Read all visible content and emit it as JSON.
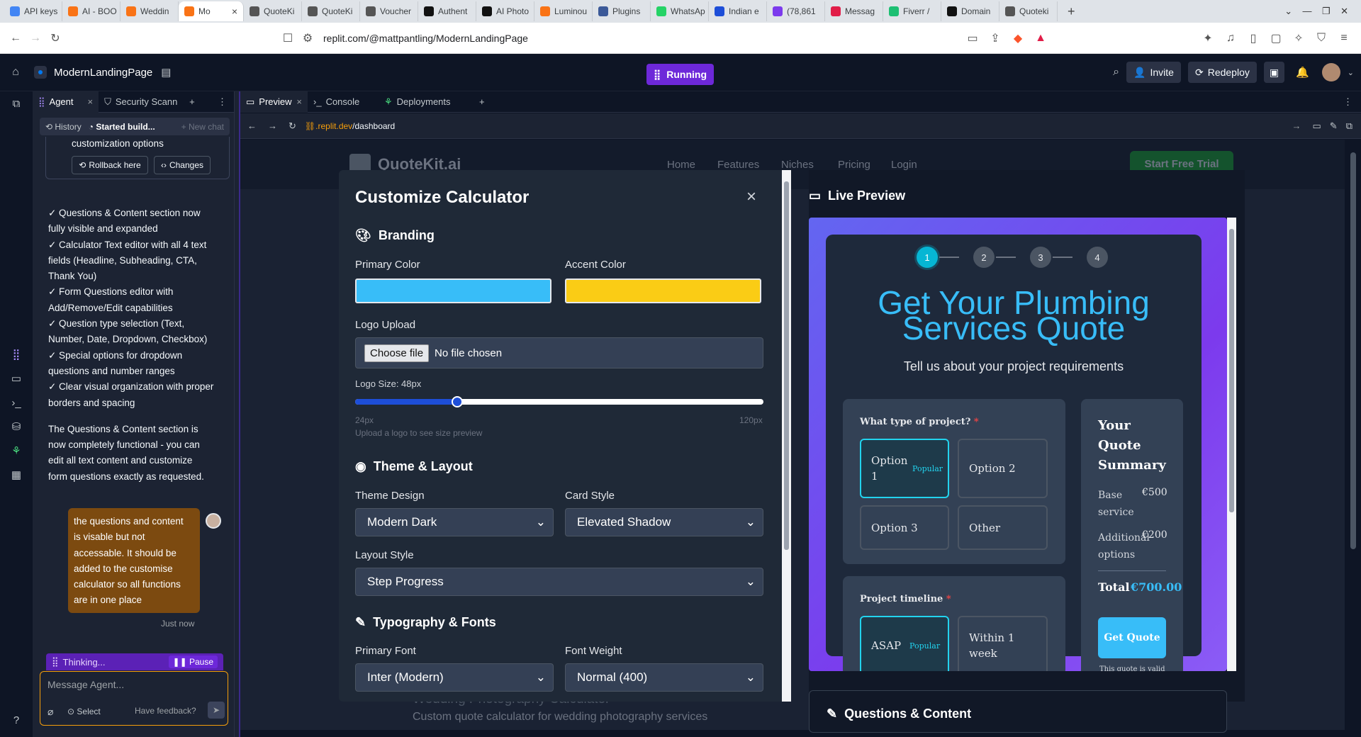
{
  "browser": {
    "tabs": [
      {
        "label": "API keys",
        "color": "#4285f4"
      },
      {
        "label": "AI - BOO",
        "color": "#f97316"
      },
      {
        "label": "Weddin",
        "color": "#f97316"
      },
      {
        "label": "Mo",
        "color": "#f97316",
        "active": true
      },
      {
        "label": "QuoteKi",
        "color": "#555555"
      },
      {
        "label": "QuoteKi",
        "color": "#555555"
      },
      {
        "label": "Voucher",
        "color": "#555555"
      },
      {
        "label": "Authent",
        "color": "#111111"
      },
      {
        "label": "AI Photo",
        "color": "#111111"
      },
      {
        "label": "Luminou",
        "color": "#f97316"
      },
      {
        "label": "Plugins",
        "color": "#3b5998"
      },
      {
        "label": "WhatsAp",
        "color": "#25d366"
      },
      {
        "label": "Indian e",
        "color": "#1d4ed8"
      },
      {
        "label": "(78,861",
        "color": "#7c3aed"
      },
      {
        "label": "Messag",
        "color": "#e11d48"
      },
      {
        "label": "Fiverr /",
        "color": "#1dbf73"
      },
      {
        "label": "Domain",
        "color": "#111111"
      },
      {
        "label": "Quoteki",
        "color": "#555555"
      }
    ],
    "url": "replit.com/@mattpantling/ModernLandingPage"
  },
  "replit": {
    "project_name": "ModernLandingPage",
    "run_status": "Running",
    "invite_label": "Invite",
    "redeploy_label": "Redeploy"
  },
  "agent_panel": {
    "tab_agent": "Agent",
    "tab_security": "Security Scann",
    "history_label": "History",
    "started_label": "Started build...",
    "new_chat_label": "New chat",
    "customization_text": "customization options",
    "rollback_label": "Rollback here",
    "changes_label": "Changes",
    "lines": [
      "✓ Questions & Content section now",
      "fully visible and expanded",
      "✓ Calculator Text editor with all 4 text",
      "fields (Headline, Subheading, CTA,",
      "Thank You)",
      "✓ Form Questions editor with",
      "Add/Remove/Edit capabilities",
      "✓ Question type selection (Text,",
      "Number, Date, Dropdown, Checkbox)",
      "✓ Special options for dropdown",
      "questions and number ranges",
      "✓ Clear visual organization with proper",
      "borders and spacing"
    ],
    "summary_lines": [
      "The Questions & Content section is",
      "now completely functional - you can",
      "edit all text content and customize",
      "form questions exactly as requested."
    ],
    "user_message_lines": [
      "the questions and content",
      "is visable but not",
      "accessable. It should be",
      "added to the customise",
      "calculator so all functions",
      "are in one place"
    ],
    "timestamp": "Just now",
    "thinking_label": "Thinking...",
    "pause_label": "Pause",
    "input_placeholder": "Message Agent...",
    "select_label": "Select",
    "feedback_label": "Have feedback?"
  },
  "workspace": {
    "tab_preview": "Preview",
    "tab_console": "Console",
    "tab_deployments": "Deployments",
    "url_domain": ".replit.dev",
    "url_path": "/dashboard"
  },
  "site": {
    "logo_text": "QuoteKit.ai",
    "nav": [
      "Home",
      "Features",
      "Niches",
      "Pricing",
      "Login"
    ],
    "cta": "Start Free Trial",
    "bg_card_title": "Wedding Photography Calculator",
    "bg_card_subtitle": "Custom quote calculator for wedding photography services"
  },
  "modal": {
    "title": "Customize Calculator",
    "branding": "Branding",
    "primary_color_label": "Primary Color",
    "primary_color": "#38bdf8",
    "accent_color_label": "Accent Color",
    "accent_color": "#facc15",
    "logo_upload_label": "Logo Upload",
    "choose_file": "Choose file",
    "no_file": "No file chosen",
    "logo_size_label": "Logo Size: 48px",
    "logo_size_value": 48,
    "logo_size_min_label": "24px",
    "logo_size_max_label": "120px",
    "logo_size_min": 24,
    "logo_size_max": 120,
    "logo_hint": "Upload a logo to see size preview",
    "theme_layout": "Theme & Layout",
    "theme_design_label": "Theme Design",
    "theme_design_value": "Modern Dark",
    "card_style_label": "Card Style",
    "card_style_value": "Elevated Shadow",
    "layout_style_label": "Layout Style",
    "layout_style_value": "Step Progress",
    "typography": "Typography & Fonts",
    "primary_font_label": "Primary Font",
    "primary_font_value": "Inter (Modern)",
    "font_weight_label": "Font Weight",
    "font_weight_value": "Normal (400)"
  },
  "preview": {
    "title": "Live Preview",
    "steps": [
      "1",
      "2",
      "3",
      "4"
    ],
    "headline_line1": "Get Your Plumbing",
    "headline_line2": "Services Quote",
    "subheading": "Tell us about your project requirements",
    "q1_label": "What type of project?",
    "q1_options": [
      "Option 1",
      "Option 2",
      "Option 3",
      "Other"
    ],
    "popular": "Popular",
    "q2_label": "Project timeline",
    "q2_options": [
      "ASAP",
      "Within 1 week"
    ],
    "summary_title_lines": [
      "Your",
      "Quote",
      "Summary"
    ],
    "base_label_lines": [
      "Base",
      "service"
    ],
    "base_value": "€500",
    "additional_label_lines": [
      "Additional",
      "options"
    ],
    "additional_value": "€200",
    "total_label": "Total",
    "total_value": "€700.00",
    "get_quote": "Get Quote",
    "valid_note": "This quote is valid",
    "questions_content_title": "Questions & Content"
  }
}
